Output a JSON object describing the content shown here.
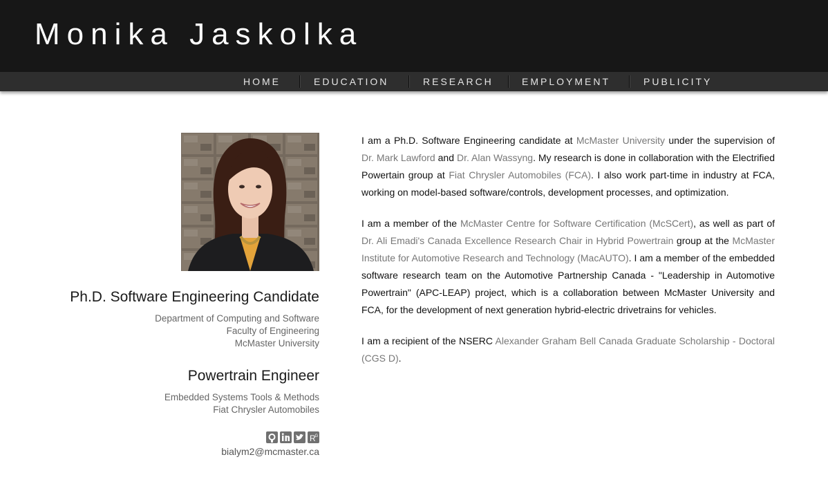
{
  "site": {
    "title": "Monika Jaskolka"
  },
  "nav": {
    "items": [
      "HOME",
      "EDUCATION",
      "RESEARCH",
      "EMPLOYMENT",
      "PUBLICITY"
    ]
  },
  "profile": {
    "photo_alt": "Monika Jaskolka portrait",
    "role1": {
      "title": "Ph.D. Software Engineering Candidate",
      "lines": [
        "Department of Computing and Software",
        "Faculty of Engineering",
        "McMaster University"
      ]
    },
    "role2": {
      "title": "Powertrain Engineer",
      "lines": [
        "Embedded Systems Tools & Methods",
        "Fiat Chrysler Automobiles"
      ]
    },
    "social_icons": [
      "github-icon",
      "linkedin-icon",
      "twitter-icon",
      "researchgate-icon"
    ],
    "email": "bialym2@mcmaster.ca"
  },
  "content": {
    "p1": {
      "t1": "I am a Ph.D. Software Engineering candidate at ",
      "link_mcmaster": "McMaster University",
      "t2": " under the supervision of ",
      "link_lawford": "Dr. Mark Lawford",
      "t3": " and ",
      "link_wassyng": "Dr. Alan Wassyng",
      "t4": ". My research is done in collaboration with the Electrified Powertain group at ",
      "link_fca": "Fiat Chrysler Automobiles (FCA)",
      "t5": ". I also work part-time in industry at FCA, working on model-based software/controls, development processes, and optimization."
    },
    "p2": {
      "t1": "I am a member of the ",
      "link_mcscert": "McMaster Centre for Software Certification (McSCert)",
      "t2": ", as well as part of ",
      "link_emadi": "Dr. Ali Emadi's Canada Excellence Research Chair in Hybrid Powertrain",
      "t3": " group at the ",
      "link_macauto": "McMaster Institute for Automotive Research and Technology (MacAUTO)",
      "t4": ". I am a member of the embedded software research team on the Automotive Partnership Canada - \"Leadership in Automotive Powertrain\" (APC-LEAP) project, which is a collaboration between McMaster University and FCA, for the development of next generation hybrid-electric drivetrains for vehicles."
    },
    "p3": {
      "t1": "I am a recipient of the NSERC ",
      "link_cgs": "Alexander Graham Bell Canada Graduate Scholarship - Doctoral (CGS D)",
      "t2": "."
    }
  },
  "colors": {
    "header_bg": "#171717",
    "nav_bg": "#2e2e2e",
    "link": "#777777"
  }
}
